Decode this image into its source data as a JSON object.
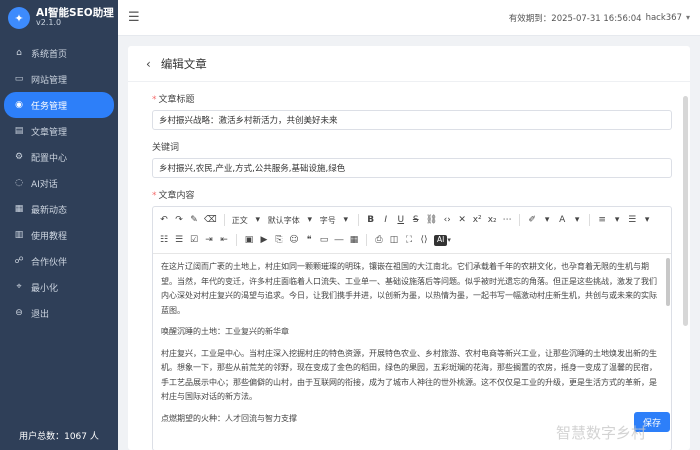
{
  "app": {
    "name": "AI智能SEO助理",
    "version": "v2.1.0"
  },
  "sidebar": {
    "items": [
      {
        "label": "系统首页",
        "icon": "home-icon"
      },
      {
        "label": "网站管理",
        "icon": "folder-icon"
      },
      {
        "label": "任务管理",
        "icon": "task-icon",
        "active": true
      },
      {
        "label": "文章管理",
        "icon": "document-icon"
      },
      {
        "label": "配置中心",
        "icon": "gear-icon"
      },
      {
        "label": "AI对话",
        "icon": "chat-icon"
      },
      {
        "label": "最新动态",
        "icon": "news-icon"
      },
      {
        "label": "使用教程",
        "icon": "book-icon"
      },
      {
        "label": "合作伙伴",
        "icon": "partner-icon"
      },
      {
        "label": "最小化",
        "icon": "minimize-icon"
      },
      {
        "label": "退出",
        "icon": "logout-icon"
      }
    ],
    "user_count": "用户总数：1067 人"
  },
  "header": {
    "expiry": "有效期到：2025-07-31 16:56:04",
    "username": "hack367"
  },
  "page": {
    "title": "编辑文章",
    "title_field_label": "文章标题",
    "title_value": "乡村振兴战略：激活乡村新活力，共创美好未来",
    "keywords_label": "关键词",
    "keywords_value": "乡村振兴,农民,产业,方式,公共服务,基础设施,绿色",
    "content_label": "文章内容",
    "save_label": "保存"
  },
  "toolbar": {
    "paragraph": "正文",
    "font_family": "默认字体",
    "font_size": "字号",
    "ai": "AI"
  },
  "content": {
    "p1": "在这片辽阔而广袤的土地上，村庄如同一颗颗璀璨的明珠，镶嵌在祖国的大江南北。它们承载着千年的农耕文化，也孕育着无限的生机与期望。当然，年代的变迁，许多村庄面临着人口流失、工业单一、基础设施落后等问题。似乎被时光遗忘的角落。但正是这些挑战，激发了我们内心深处对村庄复兴的渴望与追求。今日，让我们携手并进，以创新为墨，以热情为墨，一起书写一幅激动村庄新生机，共创与或未来的实际蓝图。",
    "h1": "唤醒沉睡的土地：工业复兴的新华章",
    "p2": "村庄复兴，工业是中心。当村庄深入挖掘村庄的特色资源，开展特色农业、乡村旅游、农村电商等新兴工业，让那些沉睡的土地焕发出新的生机。想象一下，那些从前荒芜的邻野，现在变成了金色的稻田，绿色的果园，五彩斑斓的花海，那些搁置的农房，摇身一变成了温馨的民宿，手工艺品展示中心；那些偏僻的山村，由于互联网的衔接，成为了城市人神往的世外桃源。这不仅仅是工业的升级，更是生活方式的革新，是村庄与国际对话的新方法。",
    "h2": "点燃期望的火种：人才回流与智力支撑"
  },
  "watermark": "智慧数字乡村",
  "colors": {
    "sidebar_bg": "#2f3f58",
    "accent": "#2d7ff9"
  }
}
